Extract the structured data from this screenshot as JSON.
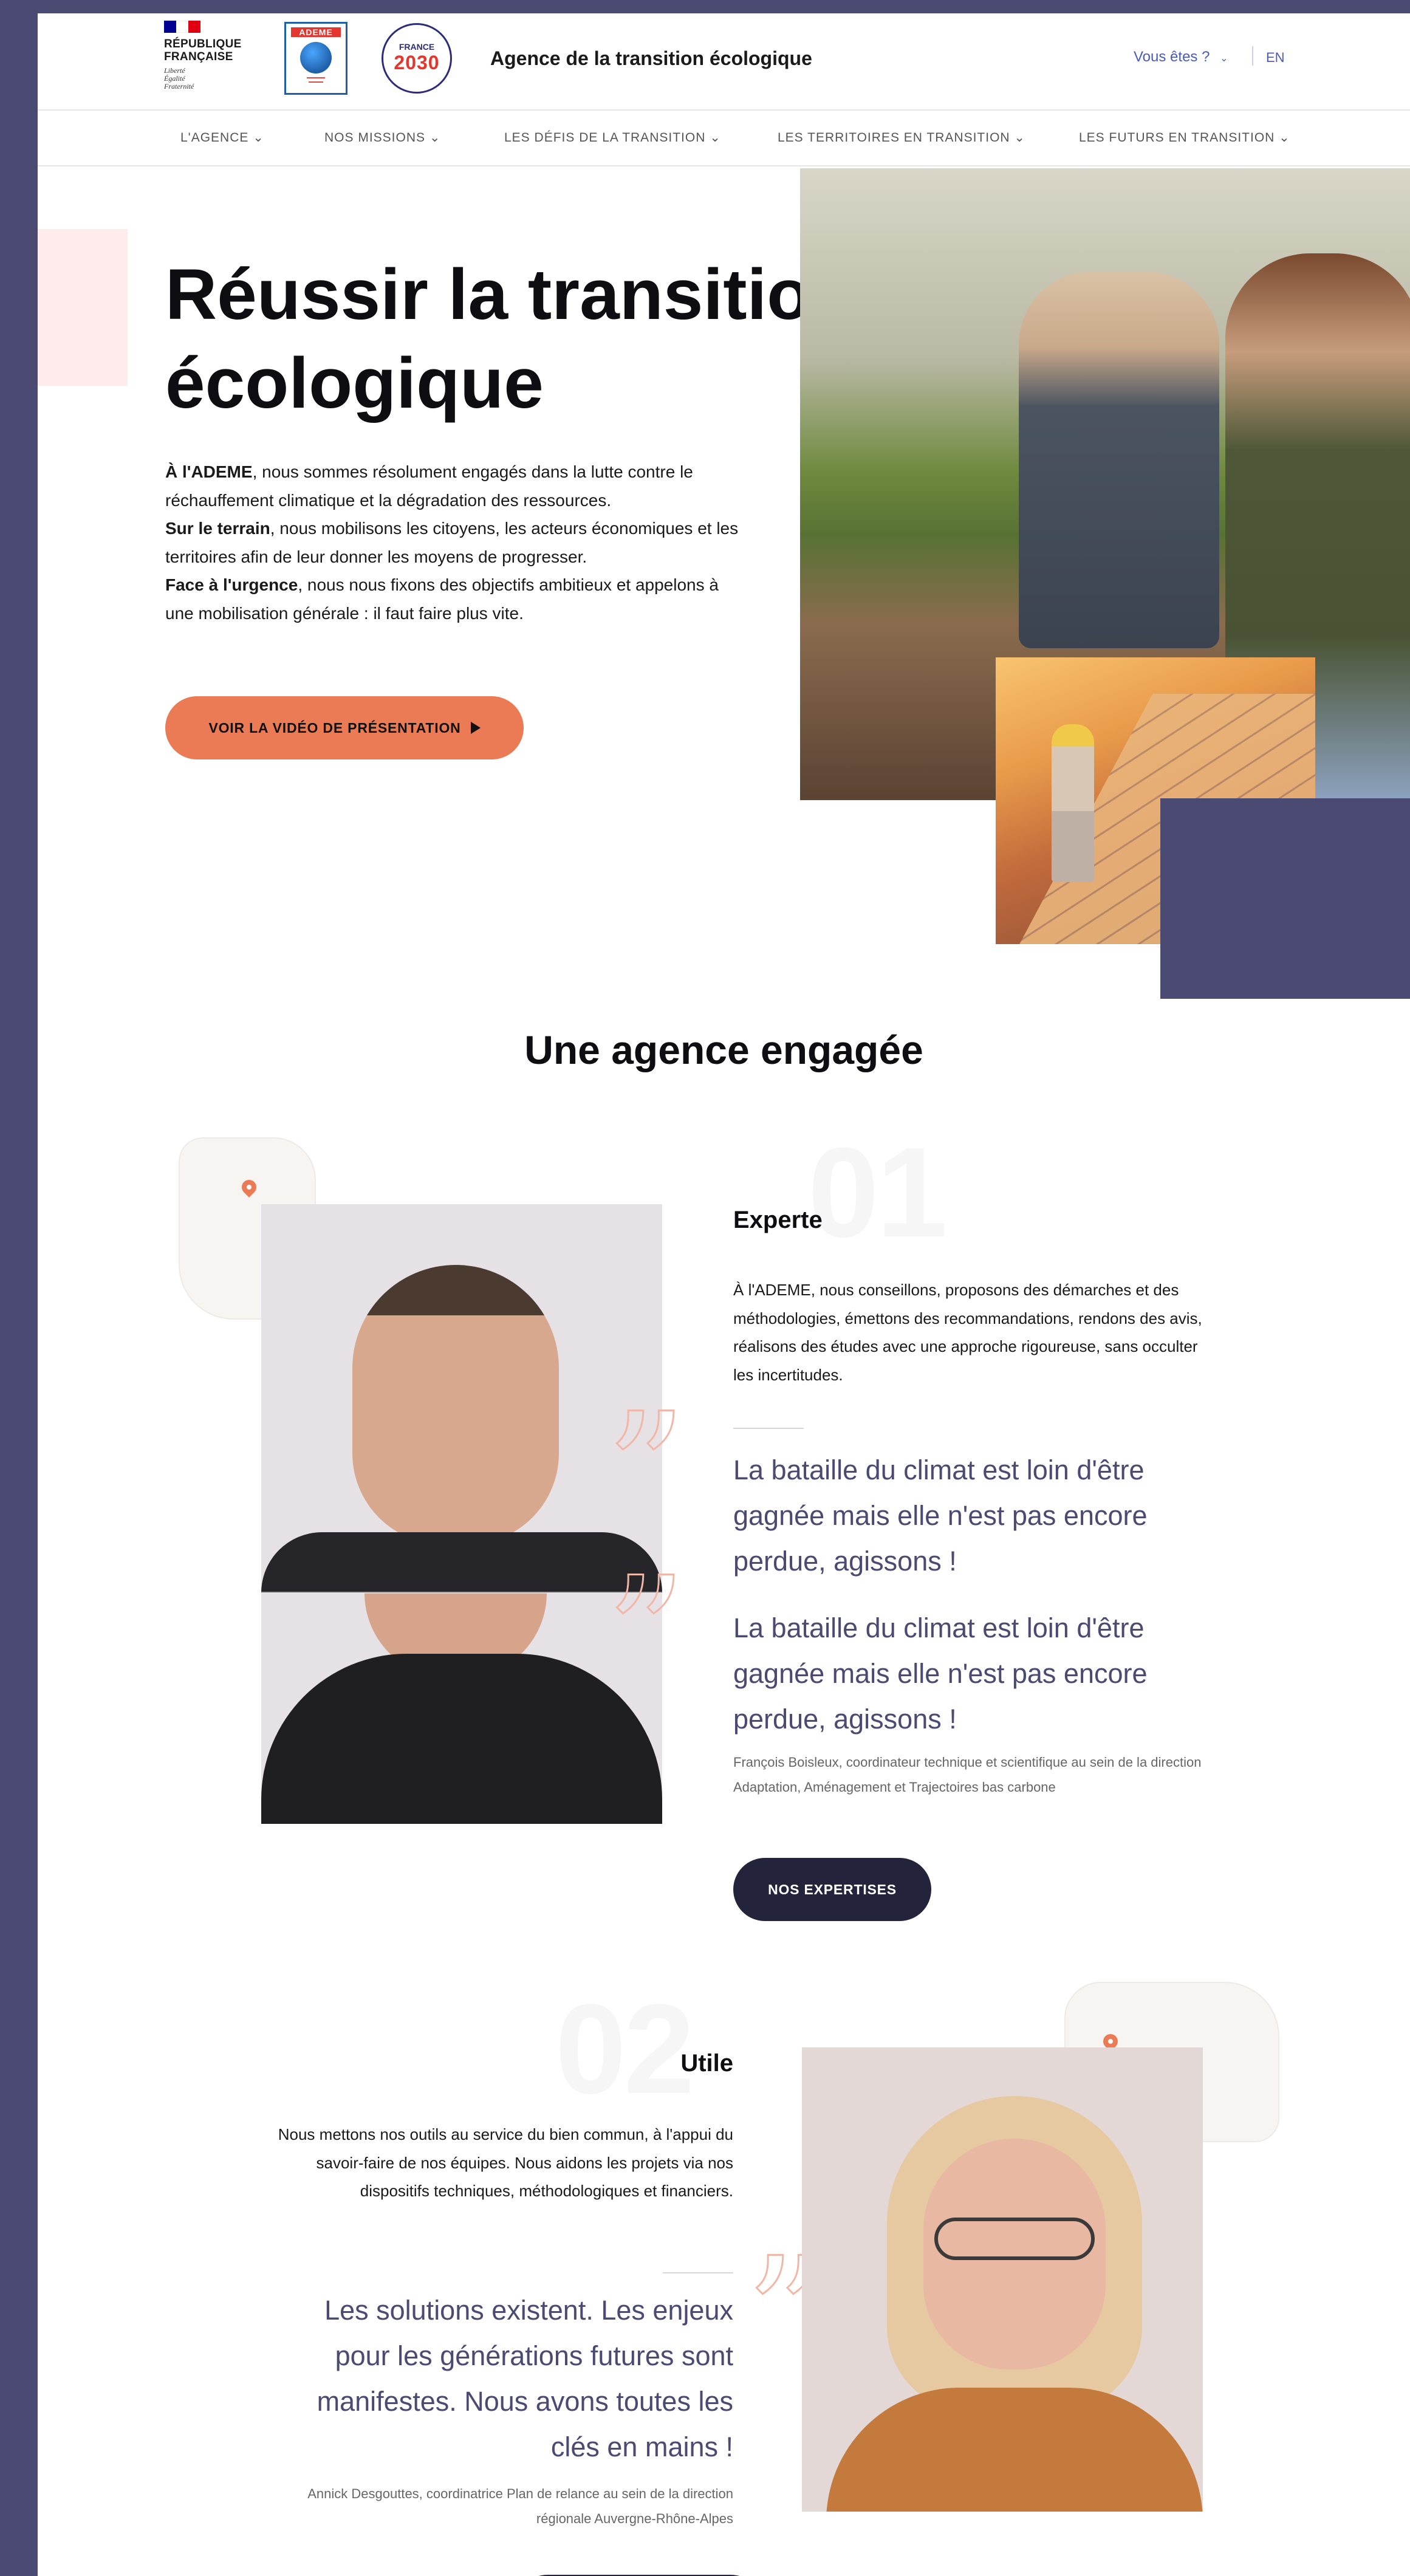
{
  "header": {
    "rf_title_line1": "RÉPUBLIQUE",
    "rf_title_line2": "FRANÇAISE",
    "rf_motto": "Liberté\nÉgalité\nFraternité",
    "ademe_logo_text": "ADEME",
    "france2030_top": "FRANCE",
    "france2030_year": "2030",
    "agency_title": "Agence de la transition écologique",
    "vous_etes": "Vous êtes ?",
    "lang": "EN"
  },
  "nav": {
    "items": [
      {
        "label": "L'AGENCE"
      },
      {
        "label": "NOS MISSIONS"
      },
      {
        "label": "LES DÉFIS DE LA TRANSITION"
      },
      {
        "label": "LES TERRITOIRES EN TRANSITION"
      },
      {
        "label": "LES FUTURS EN TRANSITION"
      }
    ]
  },
  "hero": {
    "title": "Réussir la transition écologique",
    "p1_bold": "À l'ADEME",
    "p1_rest": ", nous sommes résolument engagés dans la lutte contre le réchauffement climatique et la dégradation des ressources.",
    "p2_bold": "Sur le terrain",
    "p2_rest": ", nous mobilisons les citoyens, les acteurs économiques et les territoires afin de leur donner les moyens de progresser.",
    "p3_bold": "Face à l'urgence",
    "p3_rest": ", nous nous fixons des objectifs ambitieux et appelons à une mobilisation générale : il faut faire plus vite.",
    "cta_label": "VOIR LA VIDÉO DE PRÉSENTATION"
  },
  "engaged": {
    "title": "Une agence engagée",
    "card1": {
      "number": "01",
      "title": "Experte",
      "text": "À l'ADEME, nous conseillons, proposons des démarches et des méthodologies, émettons des recommandations, rendons des avis, réalisons des études avec une approche rigoureuse, sans occulter les incertitudes.",
      "quote1": "La bataille du climat est loin d'être gagnée mais elle n'est pas encore perdue, agissons !",
      "quote2": "La bataille du climat est loin d'être gagnée mais elle n'est pas encore perdue, agissons !",
      "author": "François Boisleux, coordinateur technique et scientifique au sein de la direction Adaptation, Aménagement et Trajectoires bas carbone",
      "button": "NOS EXPERTISES"
    },
    "card2": {
      "number": "02",
      "title": "Utile",
      "text": "Nous mettons nos outils au service du bien commun, à l'appui du savoir-faire de nos équipes. Nous aidons les projets via nos dispositifs techniques, méthodologiques et financiers.",
      "quote": "Les solutions existent. Les enjeux pour les générations futures sont manifestes. Nous avons toutes les clés en mains !",
      "author": "Annick Desgouttes, coordinatrice Plan de relance au sein de la direction régionale Auvergne-Rhône-Alpes"
    }
  },
  "colors": {
    "accent_orange": "#eb7b55",
    "navy": "#4a4a72",
    "dark_button": "#23233c",
    "link_blue": "#4b5bb8"
  }
}
